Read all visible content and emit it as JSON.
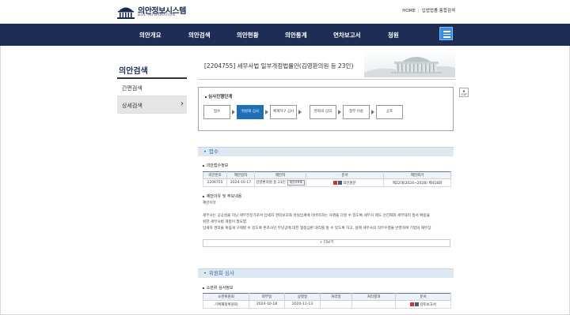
{
  "header": {
    "logo_title": "의안정보시스템",
    "logo_sub": "BILL INFORMATION",
    "links": [
      "HOME",
      "입법법률 통합검색"
    ]
  },
  "nav": {
    "items": [
      "의안개요",
      "의안검색",
      "의안현황",
      "의안통계",
      "연차보고서",
      "청원"
    ],
    "menu_icon": "hamburger-menu-icon",
    "bg_color": "#1d2d56"
  },
  "sidebar": {
    "title": "의안검색",
    "items": [
      {
        "label": "간편검색",
        "active": false
      },
      {
        "label": "상세검색",
        "active": true
      }
    ]
  },
  "bill": {
    "title": "[2204755] 세무사법 일부개정법률안(김영환의원 등 23인)"
  },
  "top_button": "TOP",
  "stages": {
    "label": "심사진행단계",
    "items": [
      "접수",
      "위원회 심사",
      "체계자구 심사",
      "본회의 심의",
      "정부 이송",
      "공포"
    ],
    "active_index": 1
  },
  "reception": {
    "section_title": "접수",
    "info_label": "의안접수정보",
    "columns": [
      "의안번호",
      "제안일자",
      "제안자",
      "문서",
      "제안회기"
    ],
    "row": {
      "bill_no": "2204755",
      "date": "2024-10-17",
      "proposer": "김영환의원 등 23인",
      "proposer_btn": "제안자목록",
      "doc": "의안원문",
      "session": "제22대(2024~2028) 제418회"
    },
    "reason_label": "제안이유 및 주요내용",
    "reason_heading": "제안이유",
    "reason_lines": [
      "세무사는 공공성을 지닌 세무전문가로서 납세자 권익보호와 성실납세에 이바지하는 사명을 다할 수 있도록 세무사 제도 선진화와 세무대리 질서 확립을",
      "위한 세무사법 개정이 필요함.",
      "납세자 권익을 폭넓게 구제할 수 있도록 존조사인 부당공에 대한 형정심판 대리를 할 수 있도록 하고, 실제 세무사의 직무수행을 반영하여 기업의 재무상"
    ],
    "more_label": "+ 더보기"
  },
  "committee": {
    "section_title": "위원회 심사",
    "info_label": "소관위 심사정보",
    "columns": [
      "소관위원회",
      "회부일",
      "상정일",
      "처리일",
      "처리결과",
      "문서"
    ],
    "row": {
      "committee": "기획재정위원회",
      "referral_date": "2024-10-18",
      "agenda_date": "2024-11-13",
      "process_date": "",
      "result": "",
      "doc": "검토보고서"
    }
  }
}
